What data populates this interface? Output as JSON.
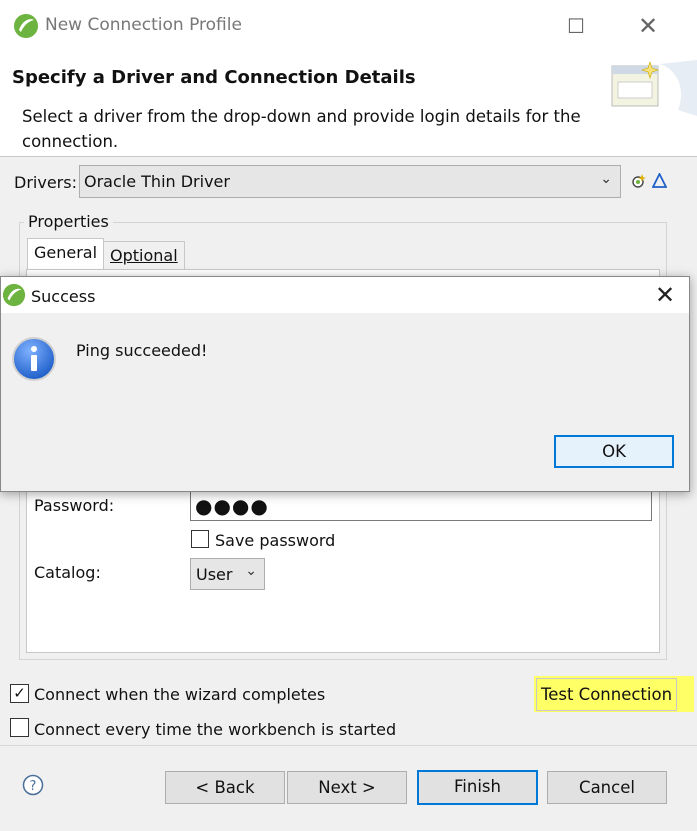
{
  "window": {
    "title": "New Connection Profile",
    "header_title": "Specify a Driver and Connection Details",
    "header_desc": "Select a driver from the drop-down and provide login details for the connection."
  },
  "drivers": {
    "label": "Drivers:",
    "selected": "Oracle Thin Driver"
  },
  "properties": {
    "group_label": "Properties",
    "tabs": [
      "General",
      "Optional"
    ],
    "password_label": "Password:",
    "password_mask": "●●●●",
    "save_password_label": "Save password",
    "save_password_checked": false,
    "catalog_label": "Catalog:",
    "catalog_value": "User"
  },
  "options": {
    "connect_on_finish_label": "Connect when the wizard completes",
    "connect_on_finish_checked": true,
    "connect_on_startup_label": "Connect every time the workbench is started",
    "connect_on_startup_checked": false
  },
  "buttons": {
    "test_connection": "Test Connection",
    "back": "< Back",
    "next": "Next >",
    "finish": "Finish",
    "cancel": "Cancel"
  },
  "dialog": {
    "title": "Success",
    "message": "Ping succeeded!",
    "ok": "OK"
  },
  "colors": {
    "highlight": "#ffff66",
    "focus_border": "#0078d7",
    "info_icon": "#1f5fc9",
    "eclipse_green": "#6db33f"
  }
}
